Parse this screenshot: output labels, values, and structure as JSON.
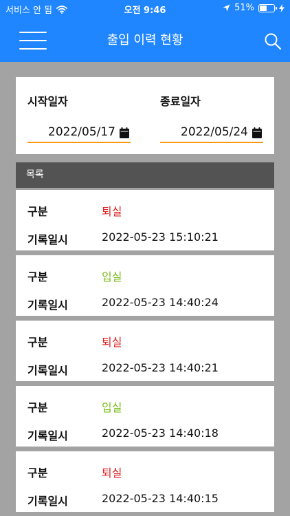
{
  "status_bar": {
    "carrier": "서비스 안 됨",
    "time": "오전 9:46",
    "battery": "51%",
    "battery_level": 0.51
  },
  "header": {
    "title": "출입 이력 현황"
  },
  "date_filter": {
    "start_label": "시작일자",
    "start_value": "2022/05/17",
    "end_label": "종료일자",
    "end_value": "2022/05/24"
  },
  "list": {
    "title": "목록",
    "type_label": "구분",
    "time_label": "기록일시",
    "records": [
      {
        "type": "퇴실",
        "time": "2022-05-23 15:10:21",
        "kind": "exit"
      },
      {
        "type": "입실",
        "time": "2022-05-23 14:40:24",
        "kind": "entry"
      },
      {
        "type": "퇴실",
        "time": "2022-05-23 14:40:21",
        "kind": "exit"
      },
      {
        "type": "입실",
        "time": "2022-05-23 14:40:18",
        "kind": "entry"
      },
      {
        "type": "퇴실",
        "time": "2022-05-23 14:40:15",
        "kind": "exit"
      }
    ]
  },
  "colors": {
    "brand": "#1f86ff",
    "exit": "#e02020",
    "entry": "#79bc19",
    "underline": "#f59a13"
  }
}
